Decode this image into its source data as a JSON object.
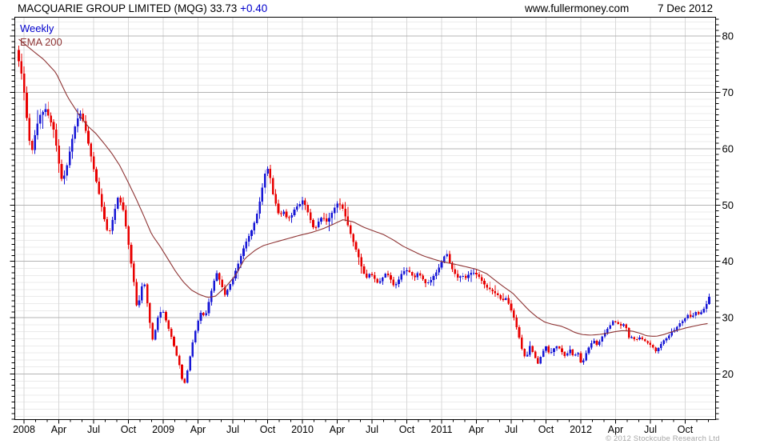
{
  "header": {
    "title": "MACQUARIE GROUP LIMITED (MQG) 33.73 ",
    "change": "+0.40",
    "watermark": "www.fullermoney.com",
    "date": "7 Dec 2012"
  },
  "legend": {
    "interval": "Weekly",
    "overlay": "EMA 200"
  },
  "footer": {
    "copyright": "© 2012 Stockcube Research Ltd"
  },
  "chart_data": {
    "type": "candlestick",
    "title": "MACQUARIE GROUP LIMITED (MQG)",
    "symbol": "MQG",
    "last": 33.73,
    "change": "+0.40",
    "interval": "Weekly",
    "overlay": "EMA 200",
    "x_axis": {
      "labels": [
        "2008",
        "Apr",
        "Jul",
        "Oct",
        "2009",
        "Apr",
        "Jul",
        "Oct",
        "2010",
        "Apr",
        "Jul",
        "Oct",
        "2011",
        "Apr",
        "Jul",
        "Oct",
        "2012",
        "Apr",
        "Jul",
        "Oct"
      ],
      "start_year": 2008,
      "end_label": "Dec 2012"
    },
    "y_axis": {
      "tick_labels": [
        "80",
        "70",
        "60",
        "50",
        "40",
        "30",
        "20"
      ],
      "tick_values": [
        80,
        70,
        60,
        50,
        40,
        30,
        20
      ],
      "range_top": 83.4,
      "range_bottom": 11.9,
      "minor_grid_step": 1.25,
      "unit_tick_step": 1
    },
    "series": {
      "close_keyframes": [
        [
          2007.963,
          75.5
        ],
        [
          2007.985,
          73
        ],
        [
          2008.006,
          69
        ],
        [
          2008.034,
          62
        ],
        [
          2008.057,
          59.5
        ],
        [
          2008.086,
          63.5
        ],
        [
          2008.115,
          66
        ],
        [
          2008.155,
          67
        ],
        [
          2008.189,
          65
        ],
        [
          2008.218,
          63
        ],
        [
          2008.246,
          58
        ],
        [
          2008.275,
          54
        ],
        [
          2008.304,
          56.5
        ],
        [
          2008.332,
          60
        ],
        [
          2008.367,
          64
        ],
        [
          2008.401,
          66.5
        ],
        [
          2008.436,
          64
        ],
        [
          2008.47,
          60
        ],
        [
          2008.504,
          56
        ],
        [
          2008.539,
          52
        ],
        [
          2008.573,
          48
        ],
        [
          2008.607,
          44.5
        ],
        [
          2008.642,
          48
        ],
        [
          2008.676,
          51.5
        ],
        [
          2008.71,
          49.5
        ],
        [
          2008.733,
          46
        ],
        [
          2008.762,
          41
        ],
        [
          2008.791,
          36
        ],
        [
          2008.814,
          31
        ],
        [
          2008.837,
          34.5
        ],
        [
          2008.86,
          37
        ],
        [
          2008.883,
          33
        ],
        [
          2008.905,
          29
        ],
        [
          2008.928,
          25.5
        ],
        [
          2008.951,
          29
        ],
        [
          2008.974,
          31
        ],
        [
          2009.003,
          31
        ],
        [
          2009.032,
          28.5
        ],
        [
          2009.054,
          27
        ],
        [
          2009.077,
          25
        ],
        [
          2009.1,
          23
        ],
        [
          2009.123,
          21
        ],
        [
          2009.146,
          17.5
        ],
        [
          2009.169,
          20
        ],
        [
          2009.192,
          23
        ],
        [
          2009.215,
          26
        ],
        [
          2009.244,
          29
        ],
        [
          2009.272,
          31
        ],
        [
          2009.301,
          30
        ],
        [
          2009.33,
          33
        ],
        [
          2009.358,
          36
        ],
        [
          2009.387,
          38
        ],
        [
          2009.415,
          36
        ],
        [
          2009.444,
          34
        ],
        [
          2009.473,
          35.5
        ],
        [
          2009.501,
          37
        ],
        [
          2009.53,
          39
        ],
        [
          2009.559,
          41
        ],
        [
          2009.587,
          43
        ],
        [
          2009.616,
          44.5
        ],
        [
          2009.645,
          46
        ],
        [
          2009.674,
          48.5
        ],
        [
          2009.696,
          51
        ],
        [
          2009.719,
          54
        ],
        [
          2009.742,
          57
        ],
        [
          2009.765,
          55.5
        ],
        [
          2009.788,
          52
        ],
        [
          2009.811,
          50
        ],
        [
          2009.834,
          48
        ],
        [
          2009.863,
          49
        ],
        [
          2009.891,
          47.5
        ],
        [
          2009.92,
          48
        ],
        [
          2009.948,
          49.5
        ],
        [
          2009.977,
          50
        ],
        [
          2010.006,
          51
        ],
        [
          2010.034,
          49
        ],
        [
          2010.063,
          47
        ],
        [
          2010.086,
          45.5
        ],
        [
          2010.115,
          47
        ],
        [
          2010.143,
          48
        ],
        [
          2010.172,
          47
        ],
        [
          2010.201,
          48
        ],
        [
          2010.229,
          49.5
        ],
        [
          2010.258,
          50.5
        ],
        [
          2010.286,
          49.5
        ],
        [
          2010.315,
          47.5
        ],
        [
          2010.344,
          45
        ],
        [
          2010.372,
          43
        ],
        [
          2010.401,
          41
        ],
        [
          2010.43,
          38.5
        ],
        [
          2010.459,
          37
        ],
        [
          2010.487,
          38
        ],
        [
          2010.516,
          37
        ],
        [
          2010.545,
          36
        ],
        [
          2010.573,
          37
        ],
        [
          2010.602,
          38
        ],
        [
          2010.63,
          37
        ],
        [
          2010.659,
          35.5
        ],
        [
          2010.688,
          36.5
        ],
        [
          2010.716,
          38
        ],
        [
          2010.745,
          38.5
        ],
        [
          2010.774,
          38
        ],
        [
          2010.802,
          37
        ],
        [
          2010.831,
          38
        ],
        [
          2010.86,
          37
        ],
        [
          2010.888,
          36
        ],
        [
          2010.917,
          36.5
        ],
        [
          2010.946,
          37.5
        ],
        [
          2010.974,
          38.5
        ],
        [
          2011.003,
          40
        ],
        [
          2011.032,
          41.5
        ],
        [
          2011.046,
          41
        ],
        [
          2011.06,
          39.5
        ],
        [
          2011.089,
          38
        ],
        [
          2011.118,
          37
        ],
        [
          2011.146,
          37.5
        ],
        [
          2011.175,
          37
        ],
        [
          2011.204,
          38
        ],
        [
          2011.232,
          38
        ],
        [
          2011.261,
          37.5
        ],
        [
          2011.29,
          36.5
        ],
        [
          2011.318,
          35.5
        ],
        [
          2011.347,
          35
        ],
        [
          2011.376,
          34.5
        ],
        [
          2011.404,
          34
        ],
        [
          2011.433,
          33
        ],
        [
          2011.462,
          33.5
        ],
        [
          2011.49,
          32
        ],
        [
          2011.519,
          30
        ],
        [
          2011.548,
          27.5
        ],
        [
          2011.576,
          24.5
        ],
        [
          2011.605,
          22.5
        ],
        [
          2011.634,
          25
        ],
        [
          2011.662,
          23.5
        ],
        [
          2011.691,
          21.8
        ],
        [
          2011.719,
          23.5
        ],
        [
          2011.748,
          25
        ],
        [
          2011.776,
          23.5
        ],
        [
          2011.805,
          24.5
        ],
        [
          2011.833,
          25
        ],
        [
          2011.862,
          24
        ],
        [
          2011.891,
          23
        ],
        [
          2011.919,
          24.5
        ],
        [
          2011.948,
          23
        ],
        [
          2011.977,
          24
        ],
        [
          2012.006,
          21.5
        ],
        [
          2012.034,
          23.5
        ],
        [
          2012.063,
          25
        ],
        [
          2012.092,
          26
        ],
        [
          2012.12,
          25
        ],
        [
          2012.149,
          26.5
        ],
        [
          2012.177,
          27.5
        ],
        [
          2012.206,
          28.5
        ],
        [
          2012.235,
          29.5
        ],
        [
          2012.263,
          29
        ],
        [
          2012.292,
          28.5
        ],
        [
          2012.32,
          29
        ],
        [
          2012.34,
          26.5
        ],
        [
          2012.366,
          26.5
        ],
        [
          2012.395,
          26
        ],
        [
          2012.424,
          26.5
        ],
        [
          2012.452,
          26
        ],
        [
          2012.481,
          25.5
        ],
        [
          2012.51,
          25
        ],
        [
          2012.539,
          24
        ],
        [
          2012.567,
          25
        ],
        [
          2012.596,
          26
        ],
        [
          2012.625,
          26.5
        ],
        [
          2012.653,
          27.5
        ],
        [
          2012.682,
          28
        ],
        [
          2012.71,
          29
        ],
        [
          2012.739,
          29.5
        ],
        [
          2012.768,
          30.5
        ],
        [
          2012.796,
          30
        ],
        [
          2012.825,
          31
        ],
        [
          2012.853,
          30.5
        ],
        [
          2012.882,
          31.5
        ],
        [
          2012.905,
          32.5
        ],
        [
          2012.923,
          33.73
        ]
      ],
      "ema_keyframes": [
        [
          2007.96,
          79.5
        ],
        [
          2008.057,
          77.5
        ],
        [
          2008.143,
          75.8
        ],
        [
          2008.229,
          73.5
        ],
        [
          2008.315,
          69.1
        ],
        [
          2008.401,
          65.8
        ],
        [
          2008.458,
          64
        ],
        [
          2008.516,
          62.7
        ],
        [
          2008.573,
          61
        ],
        [
          2008.63,
          59.2
        ],
        [
          2008.688,
          57
        ],
        [
          2008.745,
          54.2
        ],
        [
          2008.802,
          51.3
        ],
        [
          2008.86,
          48.1
        ],
        [
          2008.917,
          44.8
        ],
        [
          2008.974,
          42.8
        ],
        [
          2009.032,
          40.5
        ],
        [
          2009.089,
          38.2
        ],
        [
          2009.146,
          36.3
        ],
        [
          2009.203,
          34.9
        ],
        [
          2009.261,
          34.1
        ],
        [
          2009.318,
          33.6
        ],
        [
          2009.375,
          33.8
        ],
        [
          2009.45,
          35.5
        ],
        [
          2009.519,
          37.5
        ],
        [
          2009.587,
          40.5
        ],
        [
          2009.662,
          42
        ],
        [
          2009.719,
          42.8
        ],
        [
          2009.817,
          43.5
        ],
        [
          2009.891,
          44
        ],
        [
          2009.977,
          44.6
        ],
        [
          2010.063,
          45.1
        ],
        [
          2010.149,
          45.8
        ],
        [
          2010.223,
          46.6
        ],
        [
          2010.292,
          47.4
        ],
        [
          2010.367,
          47
        ],
        [
          2010.436,
          46.1
        ],
        [
          2010.51,
          45.4
        ],
        [
          2010.579,
          44.8
        ],
        [
          2010.653,
          43.8
        ],
        [
          2010.722,
          42.7
        ],
        [
          2010.796,
          41.8
        ],
        [
          2010.865,
          41
        ],
        [
          2010.94,
          40.4
        ],
        [
          2011.009,
          39.9
        ],
        [
          2011.112,
          39.4
        ],
        [
          2011.181,
          39
        ],
        [
          2011.249,
          38.6
        ],
        [
          2011.324,
          37.8
        ],
        [
          2011.381,
          36.7
        ],
        [
          2011.45,
          35.4
        ],
        [
          2011.513,
          34.3
        ],
        [
          2011.57,
          32.8
        ],
        [
          2011.628,
          31.3
        ],
        [
          2011.685,
          30.1
        ],
        [
          2011.742,
          29.2
        ],
        [
          2011.799,
          28.8
        ],
        [
          2011.857,
          28.5
        ],
        [
          2011.908,
          28
        ],
        [
          2011.954,
          27.4
        ],
        [
          2012.011,
          27
        ],
        [
          2012.069,
          26.9
        ],
        [
          2012.126,
          27
        ],
        [
          2012.183,
          27.2
        ],
        [
          2012.241,
          27.5
        ],
        [
          2012.298,
          27.7
        ],
        [
          2012.372,
          27.6
        ],
        [
          2012.43,
          27.2
        ],
        [
          2012.47,
          26.8
        ],
        [
          2012.51,
          26.7
        ],
        [
          2012.544,
          26.7
        ],
        [
          2012.596,
          27
        ],
        [
          2012.642,
          27.4
        ],
        [
          2012.699,
          27.8
        ],
        [
          2012.757,
          28.2
        ],
        [
          2012.814,
          28.5
        ],
        [
          2012.871,
          28.8
        ],
        [
          2012.923,
          29
        ]
      ]
    },
    "colors": {
      "up": "#1717d6",
      "down": "#e80000",
      "ema": "#8e3434",
      "accent": "#0000cc",
      "grid_major": "#b4b4b4",
      "grid_minor": "#ebebeb",
      "grid_vertical": "#d8d8d8",
      "axis": "#000000",
      "copyright": "#a6a6a6"
    }
  }
}
